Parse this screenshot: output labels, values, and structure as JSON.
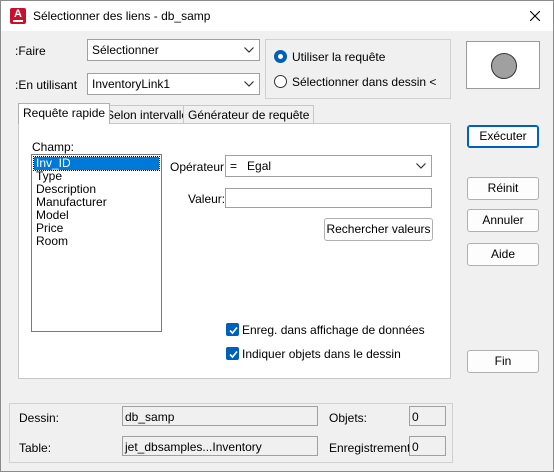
{
  "window": {
    "title": "Sélectionner des liens - db_samp",
    "app_icon_letter": "A"
  },
  "top": {
    "faire_label": ":Faire",
    "faire_value": "Sélectionner",
    "en_utilisant_label": ":En utilisant",
    "en_utilisant_value": "InventoryLink1",
    "radio_requete_label": "Utiliser la requête",
    "radio_requete_selected": true,
    "radio_dessin_label": "Sélectionner dans dessin <",
    "radio_dessin_selected": false
  },
  "tabs": [
    {
      "label": "Requête rapide",
      "active": true
    },
    {
      "label": "Selon intervalle",
      "active": false
    },
    {
      "label": "Générateur de requête",
      "active": false
    }
  ],
  "quick_query": {
    "champ_label": "Champ:",
    "fields": [
      "Inv_ID",
      "Type",
      "Description",
      "Manufacturer",
      "Model",
      "Price",
      "Room"
    ],
    "selected_field": "Inv_ID",
    "operateur_label": "Opérateur:",
    "operateur_value": "=   Egal",
    "valeur_label": "Valeur:",
    "valeur_value": "",
    "rechercher_label": "Rechercher valeurs",
    "enreg_label": "Enreg. dans affichage de données",
    "enreg_checked": true,
    "indiquer_label": "Indiquer objets dans le dessin",
    "indiquer_checked": true
  },
  "buttons": {
    "executer": "Exécuter",
    "reinit": "Réinit",
    "annuler": "Annuler",
    "aide": "Aide",
    "fin": "Fin"
  },
  "info": {
    "dessin_label": "Dessin:",
    "dessin_value": "db_samp",
    "table_label": "Table:",
    "table_value": "jet_dbsamples...Inventory",
    "objets_label": "Objets:",
    "objets_value": "0",
    "enregistrements_label": "Enregistrements:",
    "enregistrements_value": "0"
  },
  "colors": {
    "accent": "#005fb8",
    "selection": "#0078d7",
    "app_icon": "#c8102e",
    "preview_fill": "#a0a0a0"
  }
}
